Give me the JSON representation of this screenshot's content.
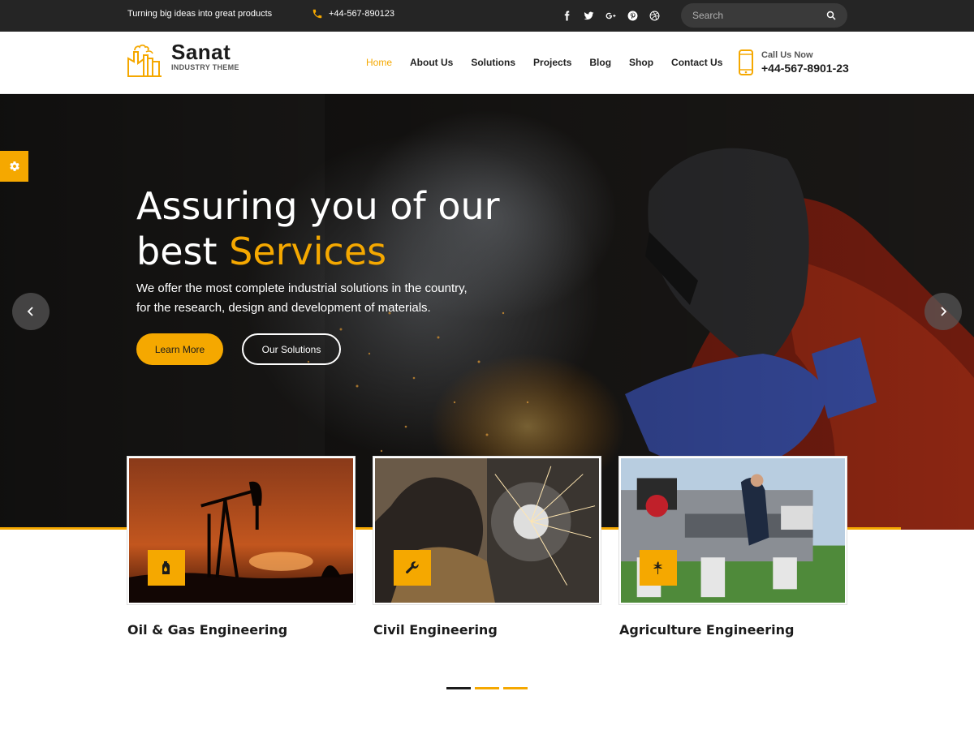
{
  "topbar": {
    "tagline": "Turning big ideas into great products",
    "phone": "+44-567-890123",
    "socials": [
      "facebook-icon",
      "twitter-icon",
      "google-plus-icon",
      "pinterest-icon",
      "dribbble-icon"
    ],
    "search_placeholder": "Search"
  },
  "header": {
    "brand": "Sanat",
    "brand_sub": "INDUSTRY THEME",
    "nav": [
      "Home",
      "About Us",
      "Solutions",
      "Projects",
      "Blog",
      "Shop",
      "Contact Us"
    ],
    "active_nav": "Home",
    "call_label": "Call Us Now",
    "call_number": "+44-567-8901-23"
  },
  "hero": {
    "title_line1": "Assuring you of our",
    "title_line2_plain": "best ",
    "title_line2_accent": "Services",
    "subtitle_line1": "We offer the most complete industrial solutions in the country,",
    "subtitle_line2": "for the research, design and development of materials.",
    "primary_button": "Learn More",
    "secondary_button": "Our Solutions"
  },
  "services": [
    {
      "title": "Oil & Gas Engineering",
      "icon": "fuel-can-icon"
    },
    {
      "title": "Civil Engineering",
      "icon": "wrench-icon"
    },
    {
      "title": "Agriculture Engineering",
      "icon": "leaf-icon"
    }
  ],
  "carousel": {
    "slides": 3,
    "active": 1
  },
  "colors": {
    "accent": "#f5a800",
    "dark": "#252525",
    "text": "#1b1b1b"
  }
}
